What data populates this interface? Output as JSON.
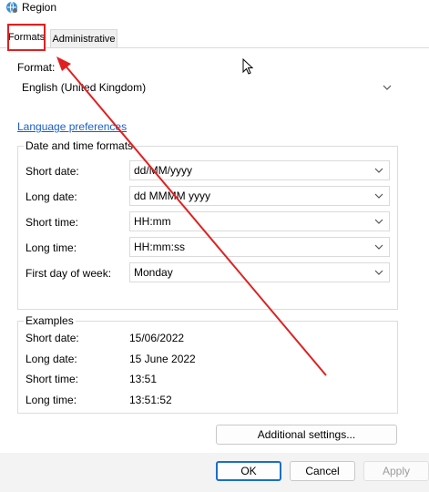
{
  "window": {
    "title": "Region",
    "icon": "globe-icon"
  },
  "tabs": [
    {
      "label": "Formats",
      "active": true
    },
    {
      "label": "Administrative",
      "active": false
    }
  ],
  "format": {
    "label": "Format:",
    "value": "English (United Kingdom)"
  },
  "language_link": "Language preferences",
  "date_time": {
    "title": "Date and time formats",
    "rows": [
      {
        "label": "Short date:",
        "value": "dd/MM/yyyy"
      },
      {
        "label": "Long date:",
        "value": "dd MMMM yyyy"
      },
      {
        "label": "Short time:",
        "value": "HH:mm"
      },
      {
        "label": "Long time:",
        "value": "HH:mm:ss"
      },
      {
        "label": "First day of week:",
        "value": "Monday"
      }
    ]
  },
  "examples": {
    "title": "Examples",
    "rows": [
      {
        "label": "Short date:",
        "value": "15/06/2022"
      },
      {
        "label": "Long date:",
        "value": "15 June 2022"
      },
      {
        "label": "Short time:",
        "value": "13:51"
      },
      {
        "label": "Long time:",
        "value": "13:51:52"
      }
    ]
  },
  "buttons": {
    "additional": "Additional settings...",
    "ok": "OK",
    "cancel": "Cancel",
    "apply": "Apply"
  },
  "colors": {
    "annotation": "#e02020",
    "link": "#1a5ec8",
    "ok_border": "#1a6ec8"
  }
}
